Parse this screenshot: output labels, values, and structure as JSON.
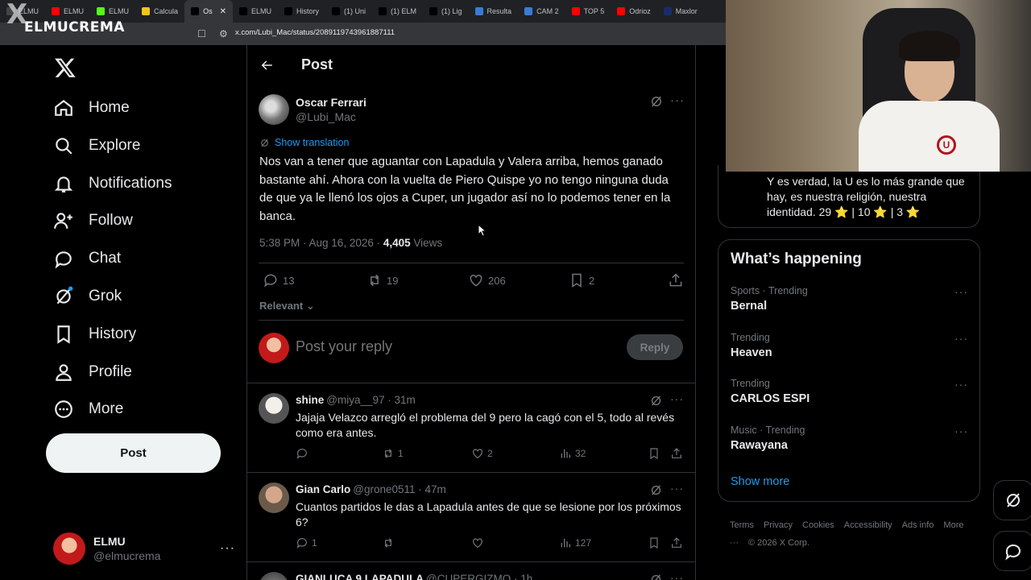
{
  "browser": {
    "tabs": [
      {
        "label": "ELMU",
        "favicon_color": "#444",
        "active": false
      },
      {
        "label": "ELMU",
        "favicon_color": "#ff0000",
        "active": false
      },
      {
        "label": "ELMU",
        "favicon_color": "#53fc18",
        "active": false
      },
      {
        "label": "Calcula",
        "favicon_color": "#f5c518",
        "active": false
      },
      {
        "label": "Os",
        "favicon_color": "#000",
        "active": true
      },
      {
        "label": "ELMU",
        "favicon_color": "#000",
        "active": false
      },
      {
        "label": "History",
        "favicon_color": "#000",
        "active": false
      },
      {
        "label": "(1) Uni",
        "favicon_color": "#000",
        "active": false
      },
      {
        "label": "(1) ELM",
        "favicon_color": "#000",
        "active": false
      },
      {
        "label": "(1) Lig",
        "favicon_color": "#000",
        "active": false
      },
      {
        "label": "Resulta",
        "favicon_color": "#3a7bd5",
        "active": false
      },
      {
        "label": "CAM 2",
        "favicon_color": "#3a7bd5",
        "active": false
      },
      {
        "label": "TOP 5",
        "favicon_color": "#ff0000",
        "active": false
      },
      {
        "label": "Odrioz",
        "favicon_color": "#ff0000",
        "active": false
      },
      {
        "label": "Maxlor",
        "favicon_color": "#1a2b6d",
        "active": false
      }
    ],
    "url": "x.com/Lubi_Mac/status/2089119743961887111",
    "brand_overlay": "ELMUCREMA"
  },
  "sidebar": {
    "nav": [
      {
        "label": "Home",
        "icon": "home-icon"
      },
      {
        "label": "Explore",
        "icon": "search-icon"
      },
      {
        "label": "Notifications",
        "icon": "bell-icon"
      },
      {
        "label": "Follow",
        "icon": "follow-icon"
      },
      {
        "label": "Chat",
        "icon": "chat-icon"
      },
      {
        "label": "Grok",
        "icon": "grok-icon"
      },
      {
        "label": "History",
        "icon": "bookmark-icon"
      },
      {
        "label": "Profile",
        "icon": "profile-icon"
      },
      {
        "label": "More",
        "icon": "more-icon"
      }
    ],
    "post_button": "Post",
    "account": {
      "name": "ELMU",
      "handle": "@elmucrema"
    }
  },
  "post": {
    "header_title": "Post",
    "author": "Oscar Ferrari",
    "handle": "@Lubi_Mac",
    "show_translation": "Show translation",
    "text": "Nos van a tener que aguantar con Lapadula y Valera arriba, hemos ganado bastante ahí. Ahora con la vuelta de Piero Quispe yo no tengo ninguna duda de que ya le llenó los ojos a Cuper, un jugador así no lo podemos tener en la banca.",
    "time": "5:38 PM · Aug 16, 2026 · ",
    "views_count": "4,405",
    "views_label": " Views",
    "replies": "13",
    "reposts": "19",
    "likes": "206",
    "bookmarks": "2",
    "sort_label": "Relevant",
    "reply_placeholder": "Post your reply",
    "reply_button": "Reply"
  },
  "replies": [
    {
      "name": "shine",
      "meta": "@miya__97 · 31m",
      "text": "Jajaja Velazco arregló el problema del 9 pero la cagó con el 5, todo al revés como era antes.",
      "replies": "",
      "reposts": "1",
      "likes": "2",
      "views": "32"
    },
    {
      "name": "Gian Carlo",
      "meta": "@grone0511 · 47m",
      "text": "Cuantos partidos le das a Lapadula antes de que se lesione por los próximos 6?",
      "replies": "1",
      "reposts": "",
      "likes": "",
      "views": "127"
    },
    {
      "name": "GIANLUCA 9 LAPADULA",
      "meta": "@CUPERGIZMO · 1h",
      "text": "",
      "replies": "",
      "reposts": "",
      "likes": "",
      "views": ""
    }
  ],
  "right": {
    "quote_text": "Y es verdad, la U es lo más grande que hay, es nuestra religión, nuestra identidad. 29 ⭐ | 10 ⭐ | 3 ⭐",
    "trends_title": "What’s happening",
    "trends": [
      {
        "meta": "Sports · Trending",
        "name": "Bernal"
      },
      {
        "meta": "Trending",
        "name": "Heaven"
      },
      {
        "meta": "Trending",
        "name": "CARLOS ESPI"
      },
      {
        "meta": "Music · Trending",
        "name": "Rawayana"
      }
    ],
    "show_more": "Show more",
    "footer": [
      "Terms",
      "Privacy",
      "Cookies",
      "Accessibility",
      "Ads info",
      "More ···",
      "© 2026 X Corp."
    ]
  },
  "colors": {
    "accent": "#1d9bf0",
    "background": "#000000",
    "border": "#2f3336",
    "muted": "#71767b"
  }
}
